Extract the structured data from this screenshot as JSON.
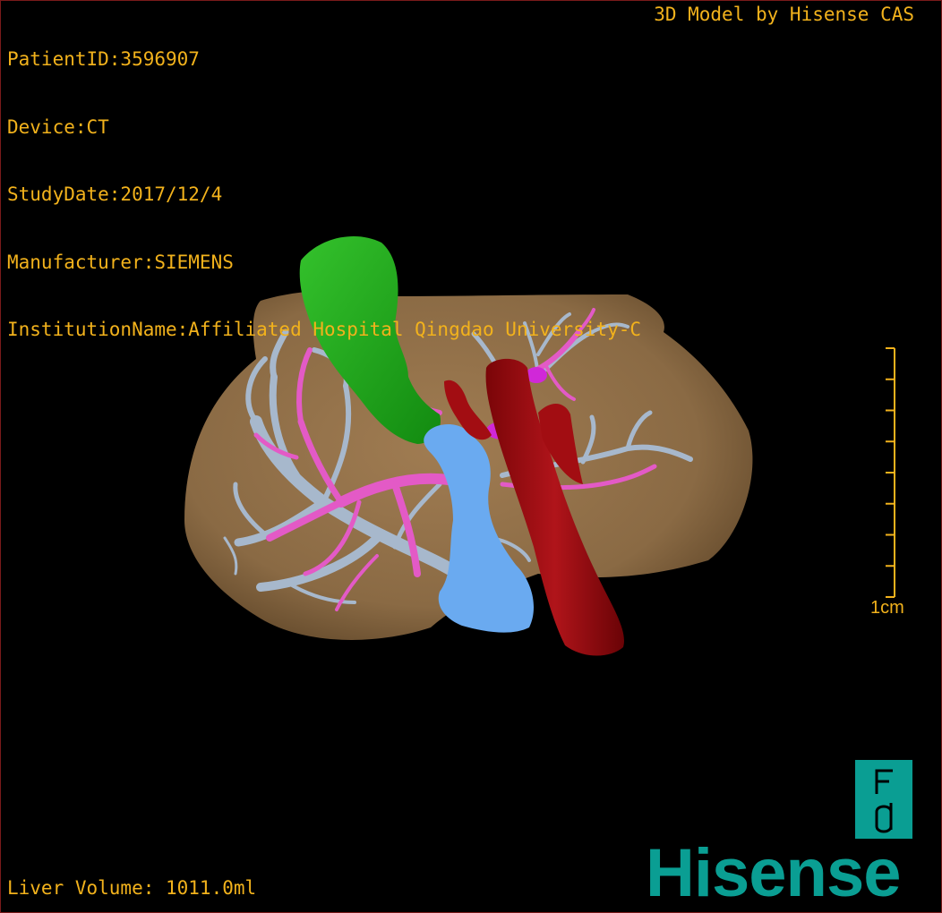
{
  "header": {
    "patient_id": "PatientID:3596907",
    "device": "Device:CT",
    "study_date": "StudyDate:2017/12/4",
    "manufacturer": "Manufacturer:SIEMENS",
    "institution": "InstitutionName:Affiliated Hospital Qingdao University-C"
  },
  "brand_caption": "3D Model by Hisense CAS",
  "liver_volume": "Liver Volume: 1011.0ml",
  "scale": {
    "label": "1cm",
    "ticks": 9
  },
  "logo": {
    "icon": "fd-logo-icon",
    "wordmark": "Hisense"
  },
  "colors": {
    "overlay_text": "#f2b21c",
    "liver": "#8a6a44",
    "gallbladder": "#1fa51a",
    "portal_vein": "#a7b8cc",
    "hepatic_artery": "#e35ac6",
    "vena_cava": "#9b0a0f",
    "hepatic_vein": "#6aaaf0",
    "brand": "#0a9e93"
  }
}
